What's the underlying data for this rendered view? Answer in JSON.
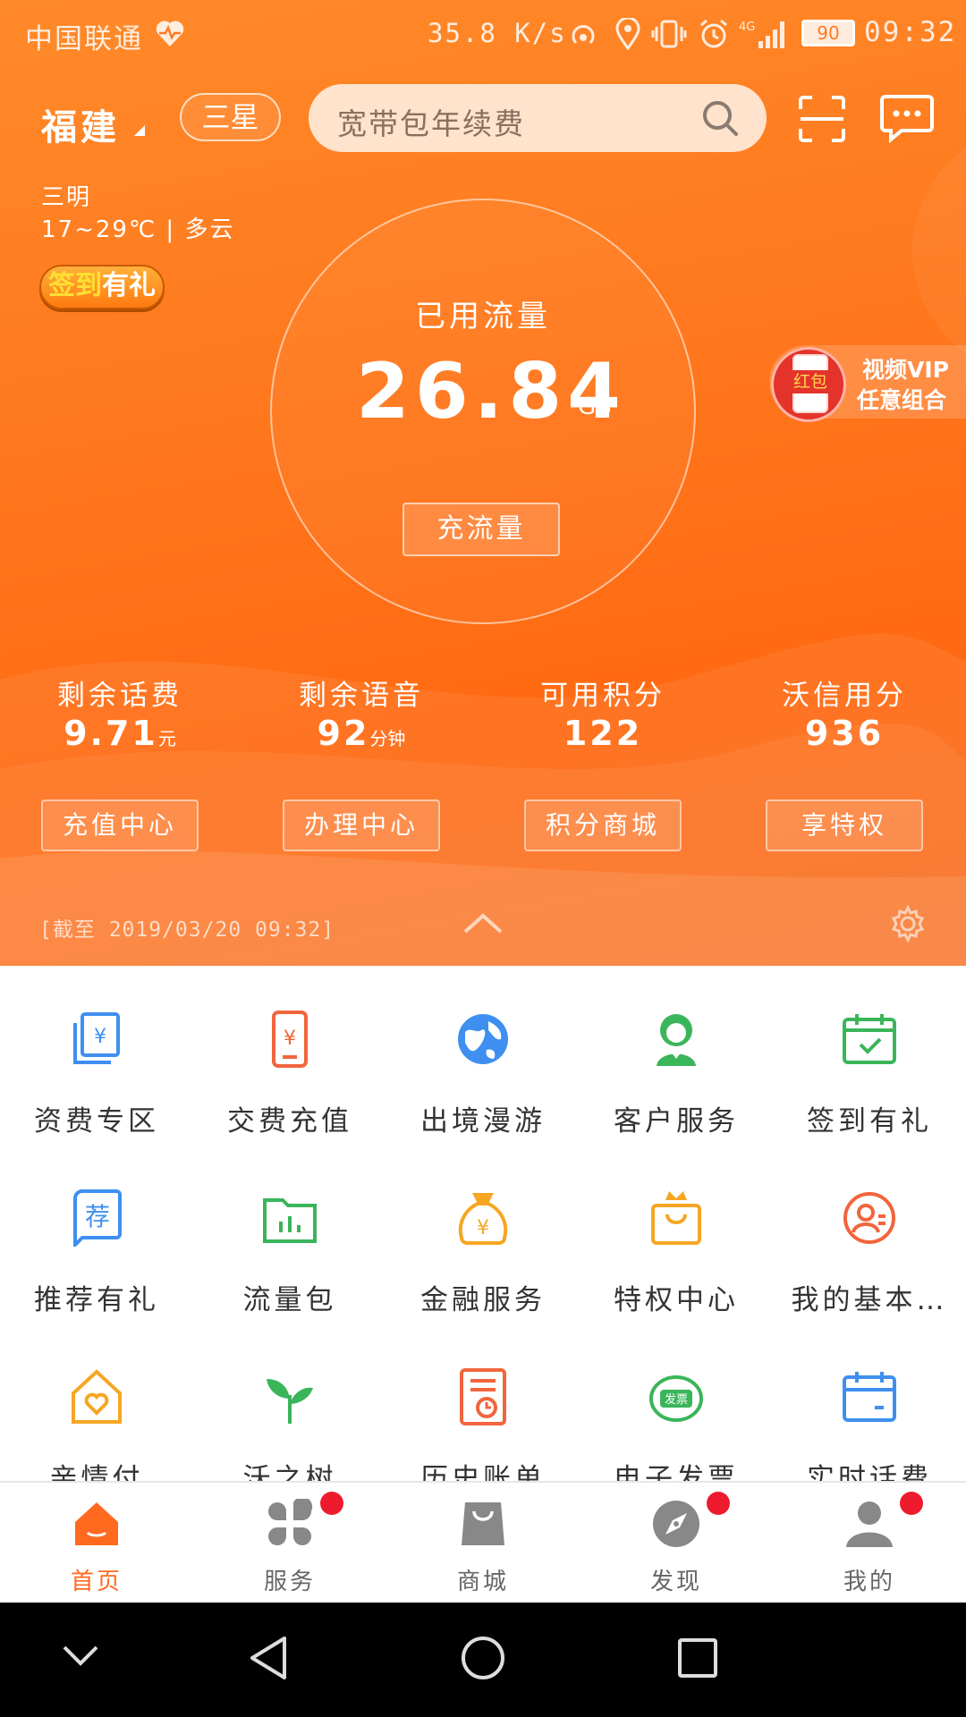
{
  "status_bar": {
    "carrier": "中国联通",
    "net_speed": "35.8 K/s",
    "battery": "90",
    "time": "09:32"
  },
  "header": {
    "province": "福建",
    "brand_chip": "三星",
    "search_placeholder": "宽带包年续费",
    "city": "三明",
    "weather": "17~29℃ | 多云",
    "checkin_a": "签到",
    "checkin_b": "有礼"
  },
  "usage": {
    "title": "已用流量",
    "value": "26.84",
    "unit": "GB",
    "recharge_label": "充流量"
  },
  "promo": {
    "badge": "红包",
    "line1": "视频VIP",
    "line2": "任意组合"
  },
  "stats": [
    {
      "label": "剩余话费",
      "value": "9.71",
      "unit": "元"
    },
    {
      "label": "剩余语音",
      "value": "92",
      "unit": "分钟"
    },
    {
      "label": "可用积分",
      "value": "122",
      "unit": ""
    },
    {
      "label": "沃信用分",
      "value": "936",
      "unit": ""
    }
  ],
  "quick_buttons": [
    "充值中心",
    "办理中心",
    "积分商城",
    "享特权"
  ],
  "as_of": "[截至 2019/03/20 09:32]",
  "services": [
    {
      "label": "资费专区",
      "icon": "tariff-icon"
    },
    {
      "label": "交费充值",
      "icon": "phone-pay-icon"
    },
    {
      "label": "出境漫游",
      "icon": "globe-icon"
    },
    {
      "label": "客户服务",
      "icon": "customer-service-icon"
    },
    {
      "label": "签到有礼",
      "icon": "calendar-check-icon"
    },
    {
      "label": "推荐有礼",
      "icon": "recommend-icon"
    },
    {
      "label": "流量包",
      "icon": "data-folder-icon"
    },
    {
      "label": "金融服务",
      "icon": "money-bag-icon"
    },
    {
      "label": "特权中心",
      "icon": "crown-bag-icon"
    },
    {
      "label": "我的基本…",
      "icon": "profile-icon"
    },
    {
      "label": "亲情付",
      "icon": "heart-house-icon"
    },
    {
      "label": "沃之树",
      "icon": "sprout-icon"
    },
    {
      "label": "历史账单",
      "icon": "bill-history-icon"
    },
    {
      "label": "电子发票",
      "icon": "invoice-icon"
    },
    {
      "label": "实时话费",
      "icon": "calendar-icon"
    }
  ],
  "invoice_icon_text": "发票",
  "nav": [
    {
      "label": "首页",
      "icon": "home-icon"
    },
    {
      "label": "服务",
      "icon": "apps-icon"
    },
    {
      "label": "商城",
      "icon": "shopping-bag-icon"
    },
    {
      "label": "发现",
      "icon": "compass-icon"
    },
    {
      "label": "我的",
      "icon": "user-icon"
    }
  ],
  "colors": {
    "brand_orange": "#ff7a1f",
    "nav_active": "#ff6a1f",
    "badge_red": "#ee1b2e"
  }
}
